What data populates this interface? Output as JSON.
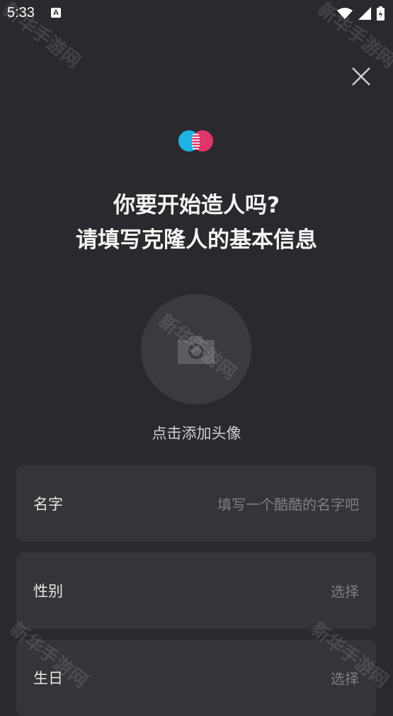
{
  "status_bar": {
    "time": "5:33",
    "notification_icon": "A"
  },
  "header": {
    "close_icon": "close-icon"
  },
  "headline": {
    "line1": "你要开始造人吗?",
    "line2": "请填写克隆人的基本信息"
  },
  "avatar": {
    "label": "点击添加头像",
    "icon": "camera-icon"
  },
  "form": {
    "rows": [
      {
        "label": "名字",
        "value": "填写一个酷酷的名字吧"
      },
      {
        "label": "性别",
        "value": "选择"
      },
      {
        "label": "生日",
        "value": "选择"
      }
    ]
  },
  "watermark": "新华手游网",
  "colors": {
    "background": "#2a2a2e",
    "card": "#353539",
    "logo_blue": "#1fb2e3",
    "logo_pink": "#e0356b"
  }
}
